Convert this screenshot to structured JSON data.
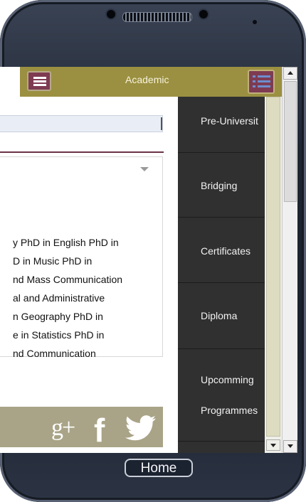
{
  "header": {
    "title": "Academic"
  },
  "search": {
    "value": ""
  },
  "programmes_text": "y PhD in English PhD in\nD in Music PhD in\nnd Mass Communication\nal and Administrative\nn Geography PhD in\ne in Statistics PhD in\nnd Communication",
  "side_nav": {
    "items": [
      {
        "label": "Pre-Universit"
      },
      {
        "label": "Bridging"
      },
      {
        "label": "Certificates"
      },
      {
        "label": "Diploma"
      },
      {
        "label": "Upcomming"
      },
      {
        "label": "Programmes"
      }
    ]
  },
  "social": {
    "gplus": "g+",
    "facebook": "f"
  },
  "device": {
    "home_label": "Home"
  },
  "colors": {
    "header": "#9b9041",
    "accent": "#7e3b52",
    "sidenav": "#303030",
    "social_bar": "#a9a487"
  }
}
